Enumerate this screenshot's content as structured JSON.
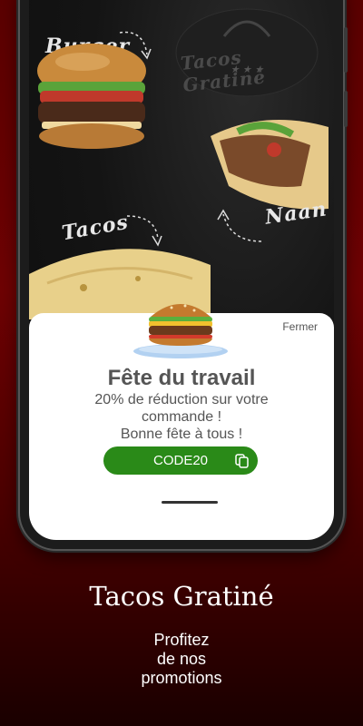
{
  "menu_labels": {
    "burger": "Burger",
    "tacos": "Tacos",
    "naan": "Naan",
    "logo": "Tacos Gratiné"
  },
  "popup": {
    "close_label": "Fermer",
    "title": "Fête du travail",
    "message": "20% de réduction sur votre\ncommande !\nBonne fête à tous !",
    "promo_code": "CODE20"
  },
  "footer": {
    "brand": "Tacos Gratiné",
    "tagline": "Profitez\nde nos\npromotions"
  },
  "colors": {
    "background": "#6e0203",
    "code_button": "#2a8a18",
    "sheet": "#ffffff"
  },
  "icons": [
    "copy-icon",
    "burger-image",
    "wrap-image",
    "tacos-image"
  ]
}
